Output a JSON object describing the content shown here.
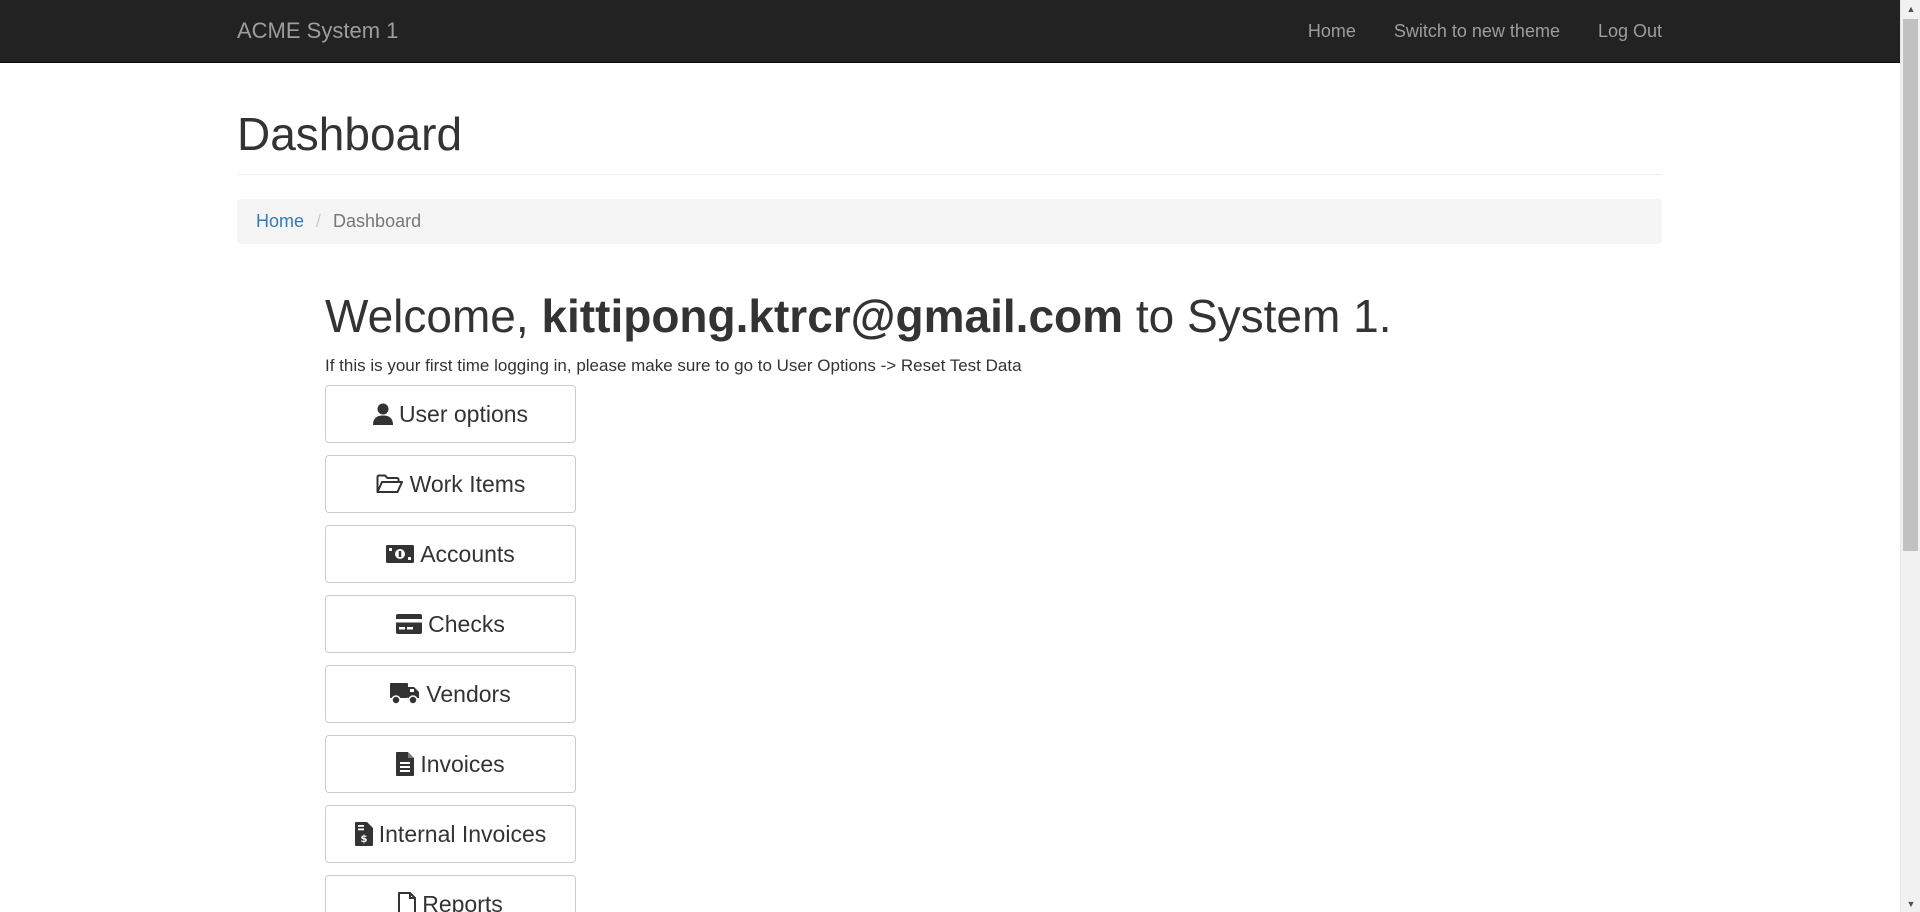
{
  "navbar": {
    "brand": "ACME System 1",
    "links": [
      "Home",
      "Switch to new theme",
      "Log Out"
    ]
  },
  "page": {
    "title": "Dashboard"
  },
  "breadcrumb": {
    "home": "Home",
    "separator": "/",
    "current": "Dashboard"
  },
  "welcome": {
    "prefix": "Welcome, ",
    "user": "kittipong.ktrcr@gmail.com",
    "suffix": " to System 1.",
    "hint": "If this is your first time logging in, please make sure to go to User Options -> Reset Test Data"
  },
  "menu": {
    "buttons": [
      {
        "label": "User options",
        "icon": "user-icon"
      },
      {
        "label": "Work Items",
        "icon": "folder-open-icon"
      },
      {
        "label": "Accounts",
        "icon": "money-bill-icon"
      },
      {
        "label": "Checks",
        "icon": "credit-card-icon"
      },
      {
        "label": "Vendors",
        "icon": "truck-icon"
      },
      {
        "label": "Invoices",
        "icon": "file-text-icon"
      },
      {
        "label": "Internal Invoices",
        "icon": "file-invoice-dollar-icon"
      },
      {
        "label": "Reports",
        "icon": "file-icon"
      }
    ]
  },
  "colors": {
    "navbar_bg": "#222222",
    "navbar_text": "#9d9d9d",
    "link": "#337ab7",
    "breadcrumb_bg": "#f5f5f5"
  }
}
